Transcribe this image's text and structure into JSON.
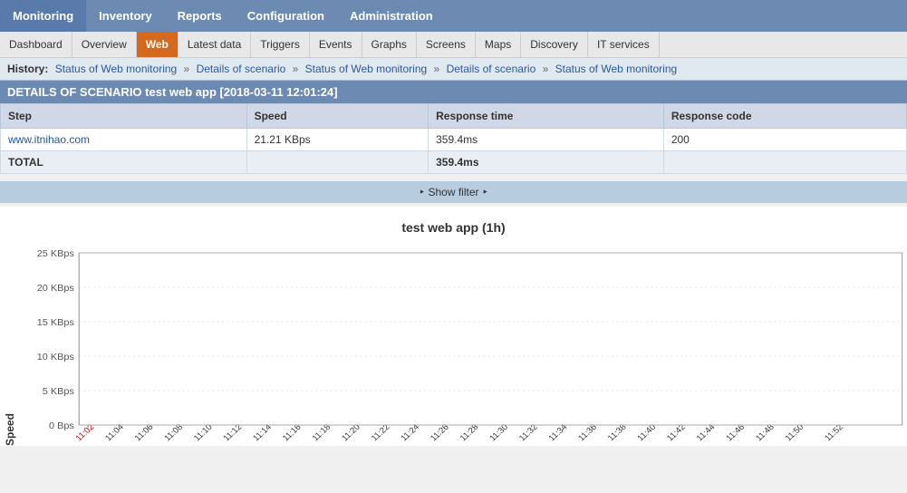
{
  "topNav": {
    "items": [
      {
        "label": "Monitoring",
        "active": true
      },
      {
        "label": "Inventory",
        "active": false
      },
      {
        "label": "Reports",
        "active": false
      },
      {
        "label": "Configuration",
        "active": false
      },
      {
        "label": "Administration",
        "active": false
      }
    ]
  },
  "secondNav": {
    "items": [
      {
        "label": "Dashboard"
      },
      {
        "label": "Overview"
      },
      {
        "label": "Web",
        "active": true
      },
      {
        "label": "Latest data"
      },
      {
        "label": "Triggers"
      },
      {
        "label": "Events"
      },
      {
        "label": "Graphs"
      },
      {
        "label": "Screens"
      },
      {
        "label": "Maps"
      },
      {
        "label": "Discovery"
      },
      {
        "label": "IT services"
      }
    ]
  },
  "breadcrumb": {
    "history_label": "History:",
    "items": [
      {
        "label": "Status of Web monitoring",
        "link": true
      },
      {
        "label": "Details of scenario",
        "link": true
      },
      {
        "label": "Status of Web monitoring",
        "link": true
      },
      {
        "label": "Details of scenario",
        "link": true
      },
      {
        "label": "Status of Web monitoring",
        "link": true
      }
    ]
  },
  "detailsHeader": "DETAILS OF SCENARIO test web app [2018-03-11 12:01:24]",
  "table": {
    "columns": [
      "Step",
      "Speed",
      "Response time",
      "Response code"
    ],
    "rows": [
      {
        "step": "www.itnihao.com",
        "speed": "21.21 KBps",
        "response_time": "359.4ms",
        "response_code": "200"
      }
    ],
    "total": {
      "label": "TOTAL",
      "speed": "",
      "response_time": "359.4ms",
      "response_code": ""
    }
  },
  "filterBar": {
    "label": "Show filter"
  },
  "chart": {
    "title": "test web app (1h)",
    "yLabel": "Speed",
    "yAxisLabels": [
      "25 KBps",
      "20 KBps",
      "15 KBps",
      "10 KBps",
      "5 KBps",
      "0 Bps"
    ],
    "xAxisLabels": [
      "11:02",
      "11:04",
      "11:06",
      "11:08",
      "11:10",
      "11:12",
      "11:14",
      "11:16",
      "11:18",
      "11:20",
      "11:22",
      "11:24",
      "11:26",
      "11:28",
      "11:30",
      "11:32",
      "11:34",
      "11:36",
      "11:38",
      "11:40",
      "11:42",
      "11:44",
      "11:46",
      "11:48",
      "11:50",
      "11:52"
    ],
    "firstXLabelRed": true
  }
}
